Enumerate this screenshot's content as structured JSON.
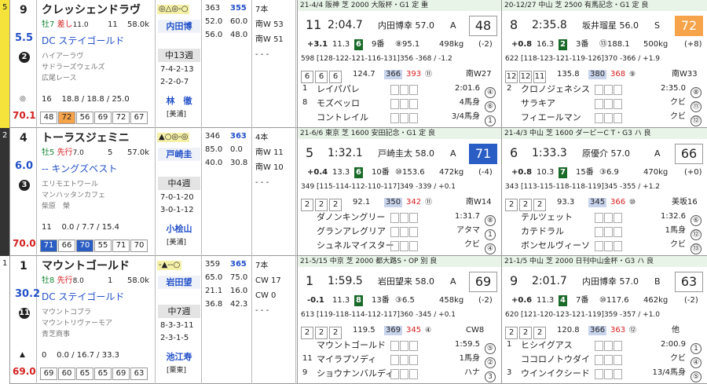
{
  "horses": [
    {
      "frame": "5",
      "frame_color": "#f5e23a",
      "num": "9",
      "name": "クレッシェンドラヴ",
      "sex_age": "牡7",
      "style": "差し",
      "style_score": "11.0",
      "pop": "11",
      "weight": "58.0k",
      "odds": "5.5",
      "rank": "2",
      "sire": "DC ステイゴールド",
      "dam": "ハイアーラヴ",
      "damsire": "サドラーズウェルズ",
      "owner": "広尾レース",
      "mark_top": "◎△◎-○",
      "score": "70.1",
      "score_mark": "◎",
      "ratings_hdr": [
        "16",
        "18.8 / 18.8 / 25.0"
      ],
      "ratings": [
        "48",
        "72",
        "56",
        "69",
        "72",
        "67"
      ],
      "ratings_hl": [
        1
      ],
      "jockey": "内田博",
      "interval": "中13週",
      "rec1": "7-4-2-13",
      "rec2": "2-2-0-7",
      "trainer": "林　徹",
      "stable": "[美浦]",
      "st": [
        [
          "363",
          "355"
        ],
        [
          "52.0",
          "60.0"
        ],
        [
          "56.0",
          "48.0"
        ]
      ],
      "pace": [
        "7本",
        "南W 53",
        "南W 51",
        "- - -"
      ],
      "r1": {
        "hdr": "21-4/4 阪神 芝 2000 大阪杯・G1 定 重",
        "pos": "11",
        "time": "2:04.7",
        "jockey": "内田博幸",
        "wt": "57.0",
        "pm": "A",
        "val": "48",
        "diff": "+3.1",
        "dist": "11.3",
        "gate": "6",
        "gatenum": "9番",
        "pop": "⑧95.1",
        "bw": "498kg",
        "bwd": "(-2)",
        "laps": "598 [128-122-121-116-131]356 -368 / -1.2",
        "corners": [
          "6",
          "6",
          "6"
        ],
        "c_extra": "124.7",
        "l3f": "366",
        "l3f2": "393",
        "l3rank": "⑪",
        "train": "南W27",
        "res": [
          [
            "1",
            "レイパパレ",
            "2:01.6",
            "④"
          ],
          [
            "8",
            "モズベッロ",
            "4馬身",
            "⑥"
          ],
          [
            "",
            "コントレイル",
            "3/4馬身",
            "1"
          ]
        ]
      },
      "r2": {
        "hdr": "20-12/27 中山 芝 2500 有馬記念・G1 定 良",
        "pos": "8",
        "time": "2:35.8",
        "jockey": "坂井瑠星",
        "wt": "56.0",
        "pm": "S",
        "val": "72",
        "diff": "+0.8",
        "dist": "16.3",
        "gate": "2",
        "gatenum": "3番",
        "pop": "⑬188.1",
        "bw": "500kg",
        "bwd": "(+8)",
        "laps": "622 [118-123-121-119-126]370 -366 / +1.9",
        "corners": [
          "12",
          "12",
          "11"
        ],
        "c_extra": "135.8",
        "l3f": "380",
        "l3f2": "368",
        "l3rank": "⑨",
        "train": "南W33",
        "res": [
          [
            "2",
            "クロノジェネシス",
            "2:35.0",
            "⑧"
          ],
          [
            "",
            "サラキア",
            "クビ",
            "⑪"
          ],
          [
            "",
            "フィエールマン",
            "クビ",
            "⑫"
          ]
        ]
      }
    },
    {
      "frame": "2",
      "frame_color": "#333333",
      "num": "4",
      "name": "トーラスジェミニ",
      "sex_age": "牡5",
      "style": "先行",
      "style_score": "7.0",
      "pop": "5",
      "weight": "57.0k",
      "odds": "6.0",
      "rank": "3",
      "sire": "-- キングズベスト",
      "dam": "エリモエトワール",
      "damsire": "マンハッタンカフェ",
      "owner": "柴原　榮",
      "mark_top": "▲○◎-◎",
      "score": "70.0",
      "score_mark": "",
      "ratings_hdr": [
        "11",
        "0.0 / 7.7 / 15.4"
      ],
      "ratings": [
        "71",
        "66",
        "70",
        "55",
        "71",
        "70"
      ],
      "ratings_hl": [
        0,
        2
      ],
      "jockey": "戸崎圭",
      "interval": "中4週",
      "rec1": "7-0-1-20",
      "rec2": "3-0-1-12",
      "trainer": "小桧山",
      "stable": "[美浦]",
      "st": [
        [
          "346",
          "363"
        ],
        [
          "85.0",
          "0.0"
        ],
        [
          "40.0",
          "30.8"
        ]
      ],
      "pace": [
        "4本",
        "南W 11",
        "南W 10",
        "- - -"
      ],
      "r1": {
        "hdr": "21-6/6 東京 芝 1600 安田記念・G1 定 良",
        "pos": "5",
        "time": "1:32.1",
        "jockey": "戸崎圭太",
        "wt": "58.0",
        "pm": "A",
        "val": "71",
        "diff": "+0.4",
        "dist": "13.3",
        "gate": "6",
        "gatenum": "10番",
        "pop": "⑩153.6",
        "bw": "472kg",
        "bwd": "(-4)",
        "laps": "349 [115-114-112-110-117]349 -339 / +0.1",
        "corners": [
          "2",
          "2",
          "2"
        ],
        "c_extra": "92.1",
        "l3f": "350",
        "l3f2": "342",
        "l3rank": "⑪",
        "train": "南W14",
        "res": [
          [
            "",
            "ダノンキングリー",
            "1:31.7",
            "⑧"
          ],
          [
            "",
            "グランアレグリア",
            "アタマ",
            "1"
          ],
          [
            "",
            "シュネルマイスター",
            "クビ",
            "④"
          ]
        ]
      },
      "r2": {
        "hdr": "21-4/3 中山 芝 1600 ダービーC T・G3 ハ 良",
        "pos": "6",
        "time": "1:33.3",
        "jockey": "原優介",
        "wt": "57.0",
        "pm": "A",
        "val": "66",
        "diff": "+0.8",
        "dist": "10.3",
        "gate": "7",
        "gatenum": "15番",
        "pop": "③6.9",
        "bw": "470kg",
        "bwd": "(+0)",
        "laps": "343 [113-115-118-118-119]345 -355 / +1.2",
        "corners": [
          "2",
          "2",
          "2"
        ],
        "c_extra": "93.3",
        "l3f": "345",
        "l3f2": "366",
        "l3rank": "⑩",
        "train": "美坂16",
        "res": [
          [
            "",
            "テルツェット",
            "1:32.6",
            "⑥"
          ],
          [
            "",
            "カテドラル",
            "1馬身",
            "⑫"
          ],
          [
            "",
            "ボンセルヴィーソ",
            "クビ",
            "⑬"
          ]
        ]
      }
    },
    {
      "frame": "1",
      "frame_color": "#ffffff",
      "num": "1",
      "name": "マウントゴールド",
      "sex_age": "牡8",
      "style": "先行",
      "style_score": "8.0",
      "pop": "1",
      "weight": "58.0k",
      "odds": "30.2",
      "rank": "11",
      "sire": "DC ステイゴールド",
      "dam": "マウントコブラ",
      "damsire": "マウントリヴァーモア",
      "owner": "青芝商事",
      "mark_top": "-▲--○",
      "score": "69.0",
      "score_mark": "▲",
      "ratings_hdr": [
        "0",
        "0.0 / 16.7 / 33.3"
      ],
      "ratings": [
        "69",
        "60",
        "65",
        "65",
        "69",
        "63"
      ],
      "ratings_hl": [],
      "jockey": "岩田望",
      "interval": "中7週",
      "rec1": "8-3-3-11",
      "rec2": "2-3-1-5",
      "trainer": "池江寿",
      "stable": "[栗東]",
      "st": [
        [
          "359",
          "365"
        ],
        [
          "65.0",
          "75.0"
        ],
        [
          "21.1",
          "16.0"
        ],
        [
          "36.8",
          "42.3"
        ]
      ],
      "pace": [
        "7本",
        "CW 17",
        "CW 0",
        "- - -"
      ],
      "r1": {
        "hdr": "21-5/15 中京 芝 2000 都大路S・OP 別 良",
        "pos": "1",
        "time": "1:59.5",
        "jockey": "岩田望来",
        "wt": "58.0",
        "pm": "A",
        "val": "69",
        "diff": "-0.1",
        "dist": "11.3",
        "gate": "8",
        "gatenum": "13番",
        "pop": "③6.5",
        "bw": "458kg",
        "bwd": "(-2)",
        "laps": "613 [119-118-114-112-117]360 -345 / +0.1",
        "corners": [
          "2",
          "2",
          "2"
        ],
        "c_extra": "119.5",
        "l3f": "369",
        "l3f2": "345",
        "l3rank": "④",
        "train": "CW8",
        "res": [
          [
            "",
            "マウントゴールド",
            "1:59.5",
            "⑤"
          ],
          [
            "11",
            "マイラプソディ",
            "1馬身",
            "②"
          ],
          [
            "9",
            "ショウナンバルディ",
            "ハナ",
            "3"
          ]
        ]
      },
      "r2": {
        "hdr": "21-1/5 中山 芝 2000 日刊中山金杯・G3 ハ 良",
        "pos": "9",
        "time": "2:01.7",
        "jockey": "内田博幸",
        "wt": "57.0",
        "pm": "B",
        "val": "63",
        "diff": "+0.6",
        "dist": "11.3",
        "gate": "4",
        "gatenum": "7番",
        "pop": "⑩117.6",
        "bw": "462kg",
        "bwd": "(-2)",
        "laps": "620 [121-120-123-121-119]359 -357 / +1.0",
        "corners": [
          "2",
          "2",
          "2"
        ],
        "c_extra": "120.8",
        "l3f": "366",
        "l3f2": "363",
        "l3rank": "⑫",
        "train": "他",
        "res": [
          [
            "1",
            "ヒシイグアス",
            "2:00.9",
            "1"
          ],
          [
            "",
            "ココロノトウダイ",
            "クビ",
            "④"
          ],
          [
            "3",
            "ウインイクシード",
            "13/4馬身",
            "⑤"
          ]
        ]
      }
    }
  ]
}
